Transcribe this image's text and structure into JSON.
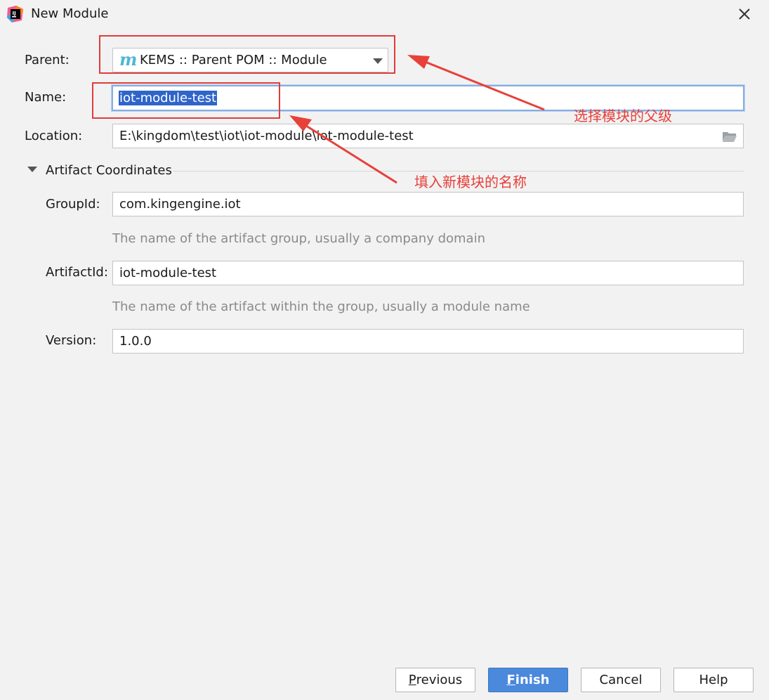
{
  "window": {
    "title": "New Module"
  },
  "parent": {
    "label": "Parent:",
    "value": "KEMS :: Parent POM :: Module",
    "icon": "maven-m-icon"
  },
  "name": {
    "label": "Name:",
    "value": "iot-module-test"
  },
  "location": {
    "label": "Location:",
    "value": "E:\\kingdom\\test\\iot\\iot-module\\iot-module-test"
  },
  "artifact_section": {
    "title": "Artifact Coordinates",
    "groupId": {
      "label": "GroupId:",
      "value": "com.kingengine.iot",
      "hint": "The name of the artifact group, usually a company domain"
    },
    "artifactId": {
      "label": "ArtifactId:",
      "value": "iot-module-test",
      "hint": "The name of the artifact within the group, usually a module name"
    },
    "version": {
      "label": "Version:",
      "value": "1.0.0"
    }
  },
  "buttons": {
    "previous": {
      "mnemonic": "P",
      "rest": "revious"
    },
    "finish": {
      "mnemonic": "F",
      "rest": "inish"
    },
    "cancel": "Cancel",
    "help": "Help"
  },
  "annotations": {
    "parent_note": "选择模块的父级",
    "name_note": "填入新模块的名称"
  },
  "colors": {
    "annotation": "#e03c3c",
    "primary_button": "#4a89dc",
    "selection": "#2f65ca",
    "focus_border": "#87aee0",
    "maven_icon": "#4fb7d6"
  }
}
